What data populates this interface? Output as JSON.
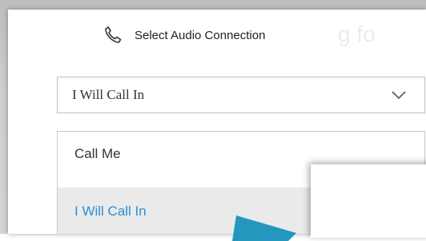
{
  "header": {
    "title": "Select Audio Connection",
    "icon": "phone-icon",
    "background_text": "g fo"
  },
  "audio_select": {
    "selected_value": "I Will Call In",
    "icon": "chevron-down-icon"
  },
  "menu": {
    "items": [
      {
        "label": "Call Me",
        "selected": false
      },
      {
        "label": "I Will Call In",
        "selected": true,
        "icon": "checkmark-icon"
      }
    ]
  },
  "colors": {
    "accent": "#2a8fd0",
    "selected_bg": "#eaeaea",
    "pointer": "#2596be"
  }
}
